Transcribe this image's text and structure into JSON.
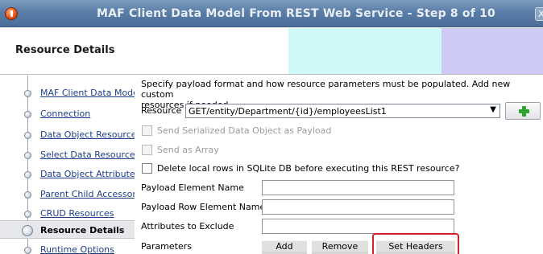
{
  "window": {
    "title": "MAF Client Data Model From REST Web Service - Step 8 of 10",
    "close_glyph": "X"
  },
  "header": {
    "title": "Resource Details",
    "band_colors": [
      "#cff8f8",
      "#cecaf6"
    ]
  },
  "nav": {
    "items": [
      {
        "label": "MAF Client Data Model",
        "active": false
      },
      {
        "label": "Connection",
        "active": false
      },
      {
        "label": "Data Object Resources",
        "active": false
      },
      {
        "label": "Select Data Resources",
        "active": false
      },
      {
        "label": "Data Object Attributes",
        "active": false
      },
      {
        "label": "Parent Child Accessors",
        "active": false
      },
      {
        "label": "CRUD Resources",
        "active": false
      },
      {
        "label": "Resource Details",
        "active": true
      },
      {
        "label": "Runtime Options",
        "active": false
      }
    ]
  },
  "main": {
    "intro_line1": "Specify payload format and how resource parameters must be populated. Add new custom",
    "intro_line2": "resources if needed.",
    "resource_label": "Resource",
    "resource_value": "GET/entity/Department/{id}/employeesList1",
    "add_resource_icon": "plus-icon",
    "send_serialized_label": "Send Serialized Data Object as Payload",
    "send_as_array_label": "Send as Array",
    "delete_local_rows_label": "Delete local rows in SQLite DB before executing this REST resource?",
    "payload_element_label": "Payload Element Name",
    "payload_element_value": "",
    "payload_row_label": "Payload Row Element Name",
    "payload_row_value": "",
    "attributes_exclude_label": "Attributes to Exclude",
    "attributes_exclude_value": "",
    "parameters_label": "Parameters",
    "add_label": "Add",
    "remove_label": "Remove",
    "set_headers_label": "Set Headers",
    "highlight_color": "#d2232a"
  }
}
